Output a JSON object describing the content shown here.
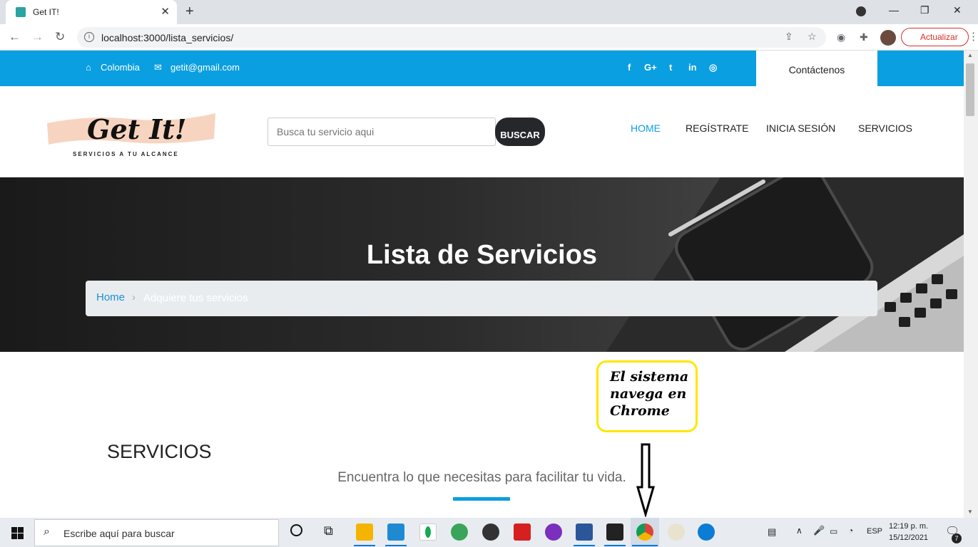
{
  "browser": {
    "tab_title": "Get IT!",
    "tab_close": "✕",
    "new_tab": "+",
    "url": "localhost:3000/lista_servicios/",
    "update_label": "Actualizar"
  },
  "topbar": {
    "location": "Colombia",
    "email": "getit@gmail.com",
    "social": [
      "f",
      "G+",
      "t",
      "in",
      "◎"
    ],
    "contact_label": "Contáctenos"
  },
  "header": {
    "logo_text": "Get It!",
    "logo_subtitle": "SERVICIOS A TU ALCANCE",
    "search_placeholder": "Busca tu servicio aqui",
    "search_button": "BUSCAR",
    "nav": [
      "HOME",
      "REGÍSTRATE",
      "INICIA SESIÓN",
      "SERVICIOS"
    ]
  },
  "hero": {
    "title": "Lista de Servicios",
    "breadcrumb_home": "Home",
    "breadcrumb_sep": "›",
    "breadcrumb_current": "Adquiere tus servicios"
  },
  "content": {
    "section_title": "SERVICIOS",
    "tagline": "Encuentra lo que necesitas para facilitar tu vida."
  },
  "annotation": {
    "line1": "El sistema",
    "line2": "navega en",
    "line3": "Chrome"
  },
  "taskbar": {
    "search_placeholder": "Escribe aquí para buscar",
    "language": "ESP",
    "time": "12:19 p. m.",
    "date": "15/12/2021",
    "notification_count": "7"
  },
  "colors": {
    "accent": "#0a9fe0",
    "callout_border": "#ffe600",
    "search_button": "#26272b"
  }
}
